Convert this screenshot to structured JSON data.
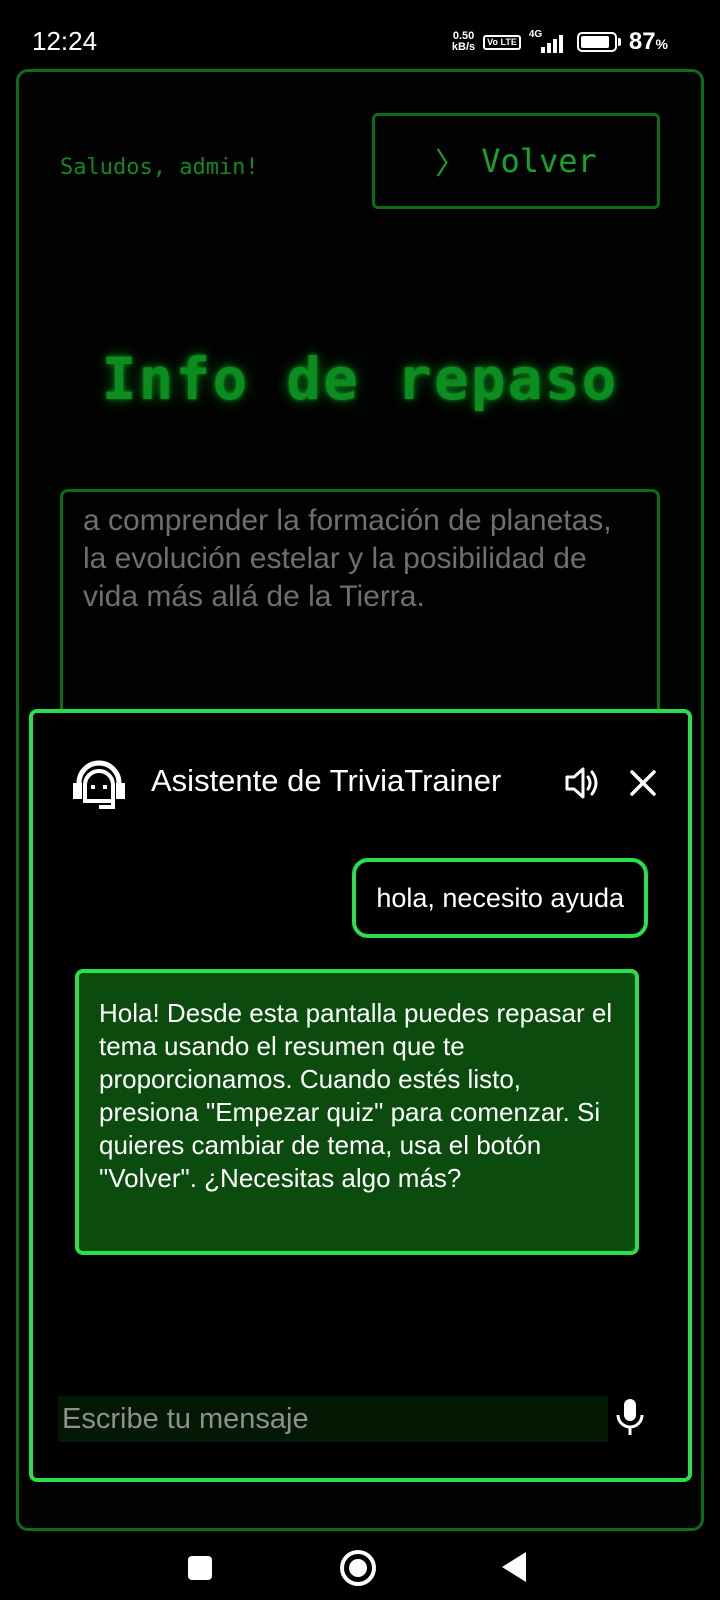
{
  "status_bar": {
    "time": "12:24",
    "net_speed_value": "0.50",
    "net_speed_unit": "kB/s",
    "volte": "Vo LTE",
    "network": "4G",
    "battery_percent": "87",
    "battery_unit": "%",
    "battery_level": 0.87
  },
  "header": {
    "greeting": "Saludos, admin!",
    "back_chevron": "〉",
    "back_label": "Volver"
  },
  "page": {
    "title": "Info de repaso",
    "summary_text": "a comprender la formación de planetas, la evolución estelar y la posibilidad de vida más allá de la Tierra."
  },
  "chat": {
    "title": "Asistente de TriviaTrainer",
    "messages": [
      {
        "role": "user",
        "text": "hola, necesito ayuda"
      },
      {
        "role": "assistant",
        "text": "Hola!  Desde esta pantalla puedes repasar el tema usando el resumen que te proporcionamos. Cuando estés listo, presiona \"Empezar quiz\" para comenzar. Si quieres cambiar de tema, usa el botón \"Volver\". ¿Necesitas algo más?"
      }
    ],
    "input_placeholder": "Escribe tu mensaje",
    "input_value": ""
  },
  "icons": {
    "bot": "support-agent-icon",
    "speaker": "speaker-icon",
    "close": "close-icon",
    "mic": "microphone-icon"
  },
  "colors": {
    "accent_bright": "#27e04b",
    "accent_dark": "#0b6d16",
    "bot_bubble": "#0b4c0e",
    "background": "#000000"
  }
}
